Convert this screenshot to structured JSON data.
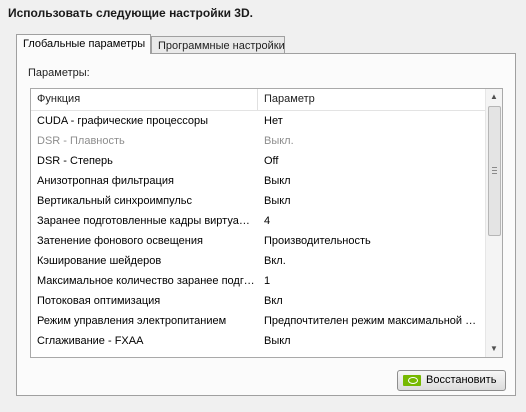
{
  "heading": "Использовать следующие настройки 3D.",
  "tabs": [
    {
      "label": "Глобальные параметры"
    },
    {
      "label": "Программные настройки"
    }
  ],
  "params_label": "Параметры:",
  "table": {
    "columns": [
      "Функция",
      "Параметр"
    ],
    "rows": [
      {
        "feature": "CUDA - графические процессоры",
        "value": "Нет"
      },
      {
        "feature": "DSR - Плавность",
        "value": "Выкл."
      },
      {
        "feature": "DSR - Степерь",
        "value": "Off"
      },
      {
        "feature": "Анизотропная фильтрация",
        "value": "Выкл"
      },
      {
        "feature": "Вертикальный синхроимпульс",
        "value": "Выкл"
      },
      {
        "feature": "Заранее подготовленные кадры виртуальной реальности",
        "value": "4"
      },
      {
        "feature": "Затенение фонового освещения",
        "value": "Производительность"
      },
      {
        "feature": "Кэширование шейдеров",
        "value": "Вкл."
      },
      {
        "feature": "Максимальное количество заранее подготовленных кадров",
        "value": "1"
      },
      {
        "feature": "Потоковая оптимизация",
        "value": "Вкл"
      },
      {
        "feature": "Режим управления электропитанием",
        "value": "Предпочтителен режим максимальной производительности"
      },
      {
        "feature": "Сглаживание - FXAA",
        "value": "Выкл"
      }
    ]
  },
  "reset_button": {
    "label": "Восстановить",
    "icon": "nvidia-logo-icon"
  },
  "colors": {
    "nvidia_green": "#76b900",
    "disabled_text": "#8d8d8d"
  }
}
